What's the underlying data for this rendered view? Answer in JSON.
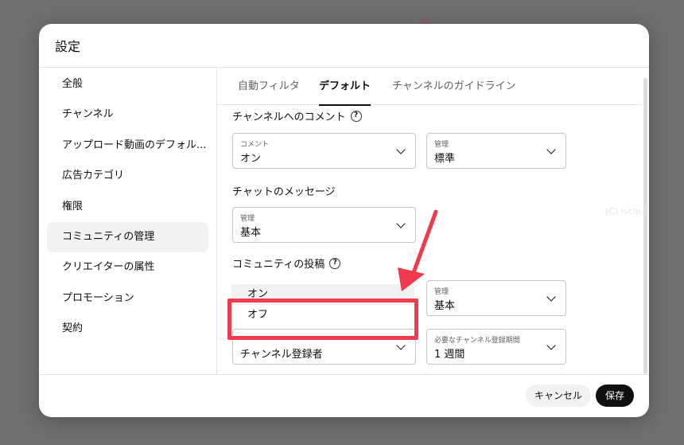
{
  "dialog": {
    "title": "設定"
  },
  "sidebar": {
    "items": [
      {
        "label": "全般"
      },
      {
        "label": "チャンネル"
      },
      {
        "label": "アップロード動画のデフォル..."
      },
      {
        "label": "広告カテゴリ"
      },
      {
        "label": "権限"
      },
      {
        "label": "コミュニティの管理",
        "active": true
      },
      {
        "label": "クリエイターの属性"
      },
      {
        "label": "プロモーション"
      },
      {
        "label": "契約"
      }
    ]
  },
  "tabs": [
    {
      "label": "自動フィルタ"
    },
    {
      "label": "デフォルト",
      "active": true
    },
    {
      "label": "チャンネルのガイドライン"
    }
  ],
  "sections": {
    "channel_comments": {
      "title": "チャンネルへのコメント",
      "comment_select": {
        "label": "コメント",
        "value": "オン"
      },
      "manage_select": {
        "label": "管理",
        "value": "標準"
      }
    },
    "chat_messages": {
      "title": "チャットのメッセージ",
      "manage_select": {
        "label": "管理",
        "value": "基本"
      }
    },
    "community_posts": {
      "title": "コミュニティの投稿",
      "dropdown_options": [
        "オン",
        "オフ"
      ],
      "manage_select": {
        "label": "管理",
        "value": "基本"
      },
      "who_select": {
        "value": "チャンネル登録者"
      },
      "period_select": {
        "label": "必要なチャンネル登録期間",
        "value": "1 週間"
      }
    }
  },
  "footer": {
    "cancel_label": "キャンセル",
    "save_label": "保存"
  },
  "watermark": "(C) iscle.c",
  "colors": {
    "highlight": "#f03a4d",
    "save_bg": "#0f0f0f"
  },
  "icons": {
    "help": "?"
  }
}
